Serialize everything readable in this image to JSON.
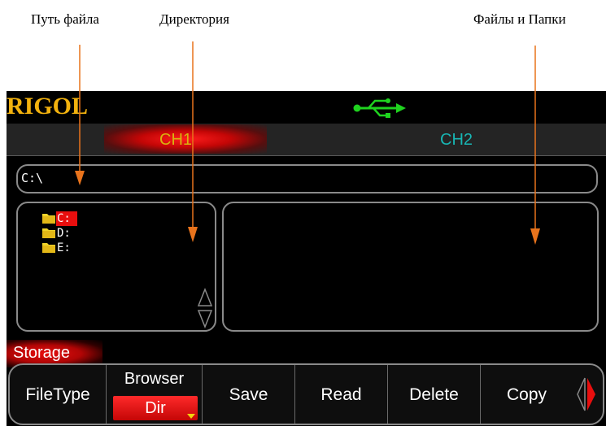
{
  "callouts": {
    "file_path": "Путь файла",
    "directory": "Директория",
    "files_folders": "Файлы и Папки"
  },
  "header": {
    "logo": "RIGOL",
    "usb_icon": "usb-icon",
    "logo_color": "#f2b20e"
  },
  "channels": {
    "ch1": "CH1",
    "ch2": "CH2",
    "ch1_color": "#d9b20f",
    "ch2_color": "#18b6b4"
  },
  "path": {
    "value": "C:\\"
  },
  "directory": {
    "items": [
      {
        "label": "C:",
        "selected": true,
        "icon": "folder-icon"
      },
      {
        "label": "D:",
        "selected": false,
        "icon": "folder-icon"
      },
      {
        "label": "E:",
        "selected": false,
        "icon": "folder-icon"
      }
    ]
  },
  "menu": {
    "title": "Storage",
    "softkeys": {
      "filetype": "FileType",
      "browser": "Browser",
      "browser_value": "Dir",
      "save": "Save",
      "read": "Read",
      "delete": "Delete",
      "copy": "Copy"
    }
  },
  "colors": {
    "accent": "#e80e0e",
    "callout_arrow": "#e8731c",
    "usb": "#1fd31f"
  }
}
